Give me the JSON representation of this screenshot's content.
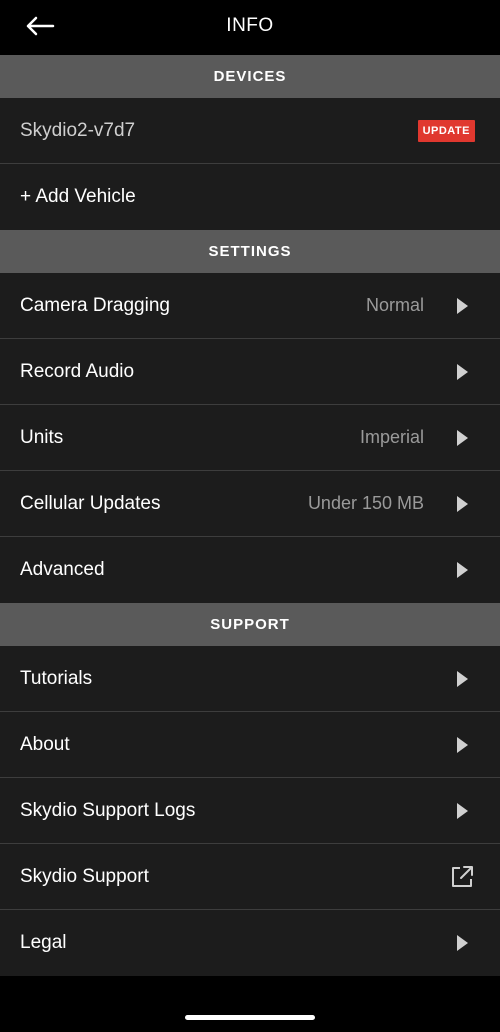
{
  "header": {
    "title": "INFO",
    "back_icon": "arrow-left-icon"
  },
  "sections": {
    "devices": {
      "title": "DEVICES",
      "device_name": "Skydio2-v7d7",
      "update_badge": "UPDATE",
      "add_vehicle": "+ Add Vehicle"
    },
    "settings": {
      "title": "SETTINGS",
      "items": [
        {
          "label": "Camera Dragging",
          "value": "Normal"
        },
        {
          "label": "Record Audio",
          "value": ""
        },
        {
          "label": "Units",
          "value": "Imperial"
        },
        {
          "label": "Cellular Updates",
          "value": "Under 150 MB"
        },
        {
          "label": "Advanced",
          "value": ""
        }
      ]
    },
    "support": {
      "title": "SUPPORT",
      "items": [
        {
          "label": "Tutorials"
        },
        {
          "label": "About"
        },
        {
          "label": "Skydio Support Logs"
        },
        {
          "label": "Skydio Support",
          "icon": "external-link-icon"
        },
        {
          "label": "Legal"
        }
      ]
    }
  },
  "colors": {
    "background": "#000000",
    "row_background": "#1c1c1c",
    "section_header": "#5a5a5a",
    "update_badge": "#e0382f",
    "secondary_text": "#9a9a9a"
  }
}
